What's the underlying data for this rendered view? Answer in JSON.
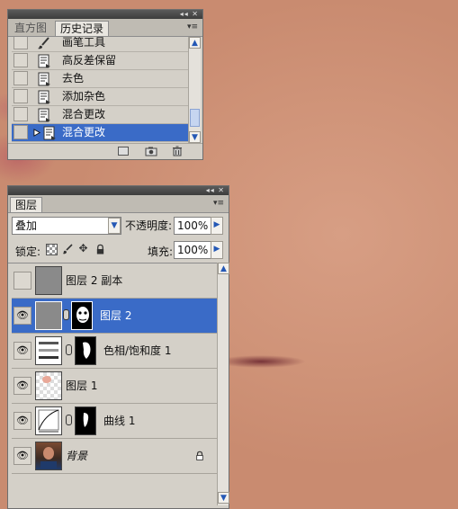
{
  "history_panel": {
    "tabs": [
      "直方图",
      "历史记录"
    ],
    "active_tab": "历史记录",
    "items": [
      {
        "label": "画笔工具",
        "icon": "brush-icon",
        "selected": false
      },
      {
        "label": "高反差保留",
        "icon": "history-state-icon",
        "selected": false
      },
      {
        "label": "去色",
        "icon": "history-state-icon",
        "selected": false
      },
      {
        "label": "添加杂色",
        "icon": "history-state-icon",
        "selected": false
      },
      {
        "label": "混合更改",
        "icon": "history-state-icon",
        "selected": false
      },
      {
        "label": "混合更改",
        "icon": "history-state-icon",
        "selected": true
      }
    ],
    "footer_icons": [
      "new-document-from-state-icon",
      "snapshot-camera-icon",
      "trash-icon"
    ]
  },
  "layers_panel": {
    "tab": "图层",
    "blend_mode": "叠加",
    "opacity_label": "不透明度:",
    "opacity_value": "100%",
    "lock_label": "锁定:",
    "fill_label": "填充:",
    "fill_value": "100%",
    "lock_icons": [
      "lock-transparency-icon",
      "lock-brush-icon",
      "lock-move-icon",
      "lock-all-icon"
    ],
    "layers": [
      {
        "name": "图层 2 副本",
        "visible": false,
        "selected": false
      },
      {
        "name": "图层 2",
        "visible": true,
        "selected": true
      },
      {
        "name": "色相/饱和度 1",
        "visible": true,
        "selected": false
      },
      {
        "name": "图层 1",
        "visible": true,
        "selected": false
      },
      {
        "name": "曲线 1",
        "visible": true,
        "selected": false
      },
      {
        "name": "背景",
        "visible": true,
        "selected": false,
        "locked": true
      }
    ]
  },
  "colors": {
    "selection": "#3a6bc7",
    "panel_bg": "#d4d0c8",
    "skin": "#cf9378"
  }
}
